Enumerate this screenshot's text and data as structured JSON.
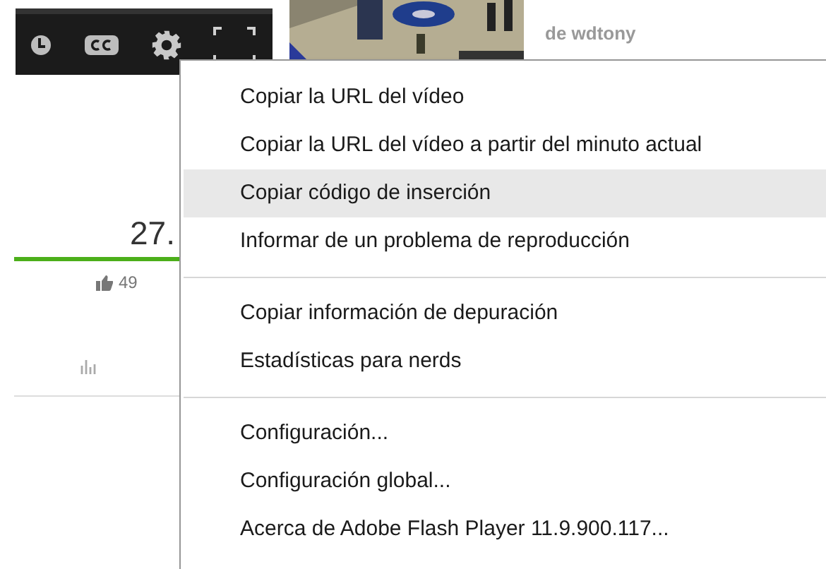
{
  "video": {
    "channel": "de wdtony"
  },
  "stats": {
    "views": "27.",
    "likes_bar": {
      "level": 1
    },
    "likes": "49"
  },
  "context_menu": {
    "groups": [
      [
        {
          "label": "Copiar la URL del vídeo",
          "selected": false
        },
        {
          "label": "Copiar la URL del vídeo a partir del minuto actual",
          "selected": false
        },
        {
          "label": "Copiar código de inserción",
          "selected": true
        },
        {
          "label": "Informar de un problema de reproducción",
          "selected": false
        }
      ],
      [
        {
          "label": "Copiar información de depuración",
          "selected": false
        },
        {
          "label": "Estadísticas para nerds",
          "selected": false
        }
      ],
      [
        {
          "label": "Configuración...",
          "selected": false
        },
        {
          "label": "Configuración global...",
          "selected": false
        },
        {
          "label": "Acerca de Adobe Flash Player 11.9.900.117...",
          "selected": false
        }
      ]
    ]
  }
}
